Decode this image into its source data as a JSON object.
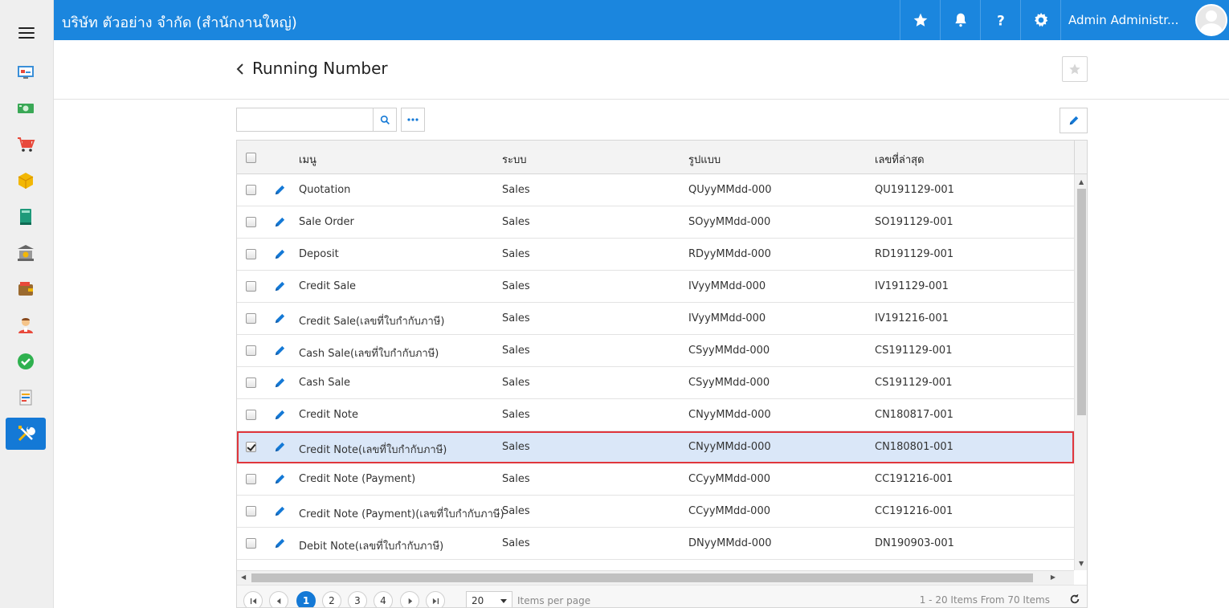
{
  "topbar": {
    "company": "บริษัท ตัวอย่าง จำกัด (สำนักงานใหญ่)",
    "user_name": "Admin Administr...",
    "accent_color": "#1b86de"
  },
  "sidebar": {
    "items": [
      {
        "icon": "dashboard-icon"
      },
      {
        "icon": "money-icon"
      },
      {
        "icon": "cart-icon"
      },
      {
        "icon": "box-icon"
      },
      {
        "icon": "book-icon"
      },
      {
        "icon": "bank-icon"
      },
      {
        "icon": "wallet-icon"
      },
      {
        "icon": "person-icon"
      },
      {
        "icon": "check-icon"
      },
      {
        "icon": "report-icon"
      },
      {
        "icon": "tools-icon",
        "active": true
      }
    ]
  },
  "page": {
    "title": "Running Number"
  },
  "search": {
    "value": "",
    "placeholder": ""
  },
  "table": {
    "headers": {
      "menu": "เมนู",
      "system": "ระบบ",
      "format": "รูปแบบ",
      "last_number": "เลขที่ล่าสุด"
    },
    "rows": [
      {
        "menu": "Quotation",
        "system": "Sales",
        "format": "QUyyMMdd-000",
        "last": "QU191129-001",
        "checked": false
      },
      {
        "menu": "Sale Order",
        "system": "Sales",
        "format": "SOyyMMdd-000",
        "last": "SO191129-001",
        "checked": false
      },
      {
        "menu": "Deposit",
        "system": "Sales",
        "format": "RDyyMMdd-000",
        "last": "RD191129-001",
        "checked": false
      },
      {
        "menu": "Credit Sale",
        "system": "Sales",
        "format": "IVyyMMdd-000",
        "last": "IV191129-001",
        "checked": false
      },
      {
        "menu": "Credit Sale(เลขที่ใบกำกับภาษี)",
        "system": "Sales",
        "format": "IVyyMMdd-000",
        "last": "IV191216-001",
        "checked": false
      },
      {
        "menu": "Cash Sale(เลขที่ใบกำกับภาษี)",
        "system": "Sales",
        "format": "CSyyMMdd-000",
        "last": "CS191129-001",
        "checked": false
      },
      {
        "menu": "Cash Sale",
        "system": "Sales",
        "format": "CSyyMMdd-000",
        "last": "CS191129-001",
        "checked": false
      },
      {
        "menu": "Credit Note",
        "system": "Sales",
        "format": "CNyyMMdd-000",
        "last": "CN180817-001",
        "checked": false
      },
      {
        "menu": "Credit Note(เลขที่ใบกำกับภาษี)",
        "system": "Sales",
        "format": "CNyyMMdd-000",
        "last": "CN180801-001",
        "checked": true
      },
      {
        "menu": "Credit Note (Payment)",
        "system": "Sales",
        "format": "CCyyMMdd-000",
        "last": "CC191216-001",
        "checked": false
      },
      {
        "menu": "Credit Note (Payment)(เลขที่ใบกำกับภาษี)",
        "system": "Sales",
        "format": "CCyyMMdd-000",
        "last": "CC191216-001",
        "checked": false
      },
      {
        "menu": "Debit Note(เลขที่ใบกำกับภาษี)",
        "system": "Sales",
        "format": "DNyyMMdd-000",
        "last": "DN190903-001",
        "checked": false
      }
    ]
  },
  "pager": {
    "pages": [
      "1",
      "2",
      "3",
      "4"
    ],
    "current": "1",
    "page_size": "20",
    "items_per_page_label": "Items per page",
    "info": "1 - 20 Items From 70 Items"
  }
}
